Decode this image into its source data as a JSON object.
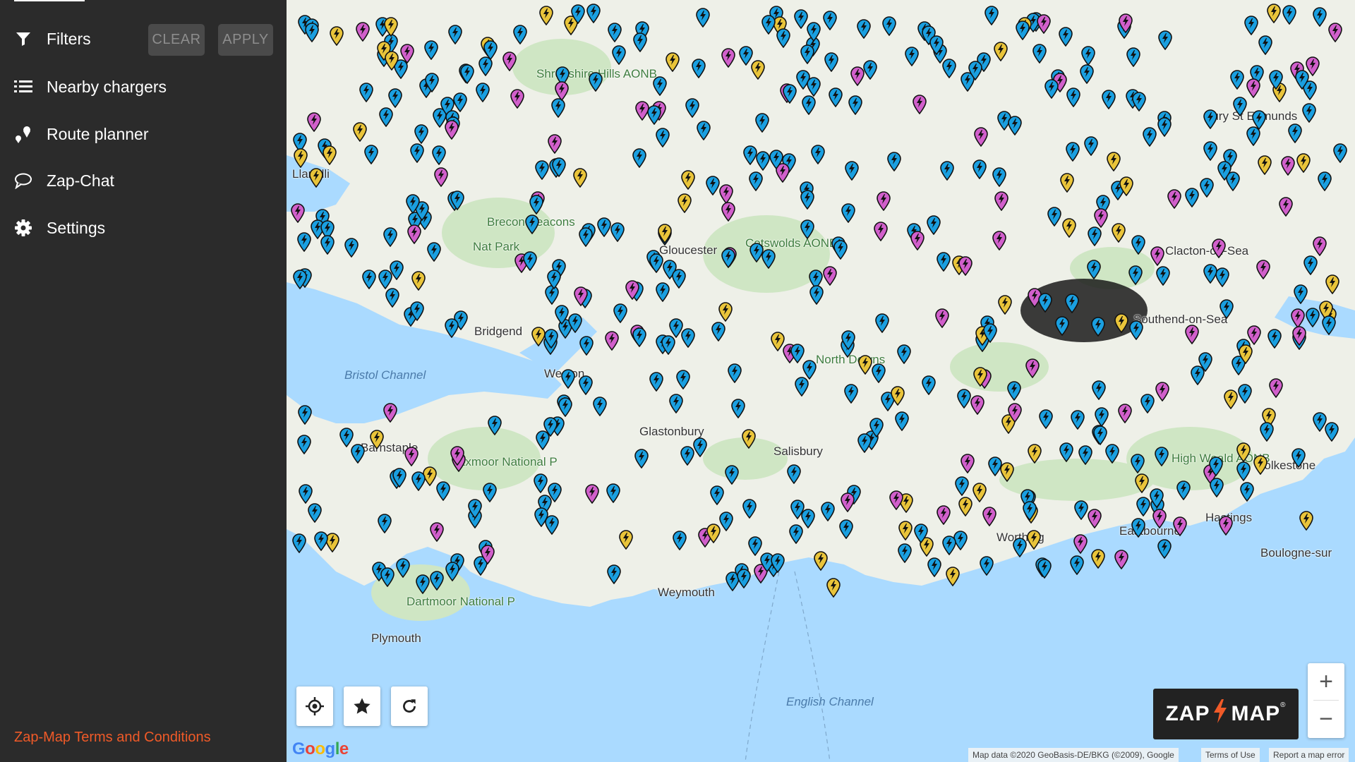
{
  "sidebar": {
    "filters_label": "Filters",
    "clear_label": "CLEAR",
    "apply_label": "APPLY",
    "items": [
      {
        "label": "Nearby chargers",
        "icon": "list-icon"
      },
      {
        "label": "Route planner",
        "icon": "route-icon"
      },
      {
        "label": "Zap-Chat",
        "icon": "chat-icon"
      },
      {
        "label": "Settings",
        "icon": "gear-icon"
      }
    ],
    "terms_label": "Zap-Map Terms and Conditions"
  },
  "map": {
    "places": {
      "shropshire_hills": "Shropshire Hills AONB",
      "brecon_beacons": "Brecon Beacons",
      "national_park_abbr": "Nat Park",
      "bristol_channel": "Bristol Channel",
      "weston": "Weston",
      "exmoor": "Exmoor National P",
      "dartmoor": "Dartmoor National P",
      "weymouth": "Weymouth",
      "english_channel": "English Channel",
      "worthing": "Worthing",
      "eastbourne": "Eastbourne",
      "hastings": "Hastings",
      "folkestone": "Folkestone",
      "boulogne": "Boulogne-sur",
      "clacton": "Clacton-on-Sea",
      "southend": "Southend-on-Sea",
      "high_weald": "High Weald AONB",
      "north_downs": "North Downs",
      "cotswolds": "Cotswolds AONB",
      "bury": "Bury St Edmunds",
      "gloucester": "Gloucester",
      "salisbury": "Salisbury",
      "glastonbury": "Glastonbury",
      "bridgend": "Bridgend",
      "llanelli": "Llanelli",
      "plymouth": "Plymouth",
      "barnstaple": "Barnstaple"
    },
    "controls": {
      "locate_icon": "crosshair-icon",
      "favourite_icon": "star-icon",
      "refresh_icon": "refresh-icon",
      "zoom_in": "+",
      "zoom_out": "−"
    },
    "logo_left": "ZAP",
    "logo_right": "MAP",
    "logo_reg": "®",
    "google": "Google",
    "attribution": {
      "map_data": "Map data ©2020 GeoBasis-DE/BKG (©2009), Google",
      "terms": "Terms of Use",
      "report": "Report a map error"
    },
    "colors": {
      "land": "#eef0e8",
      "park": "#cfe6c4",
      "sea": "#aadaff",
      "pin_blue": "#1a9fe0",
      "pin_pink": "#d15fcb",
      "pin_yellow": "#e9c43a",
      "pin_outline": "#111111"
    }
  }
}
